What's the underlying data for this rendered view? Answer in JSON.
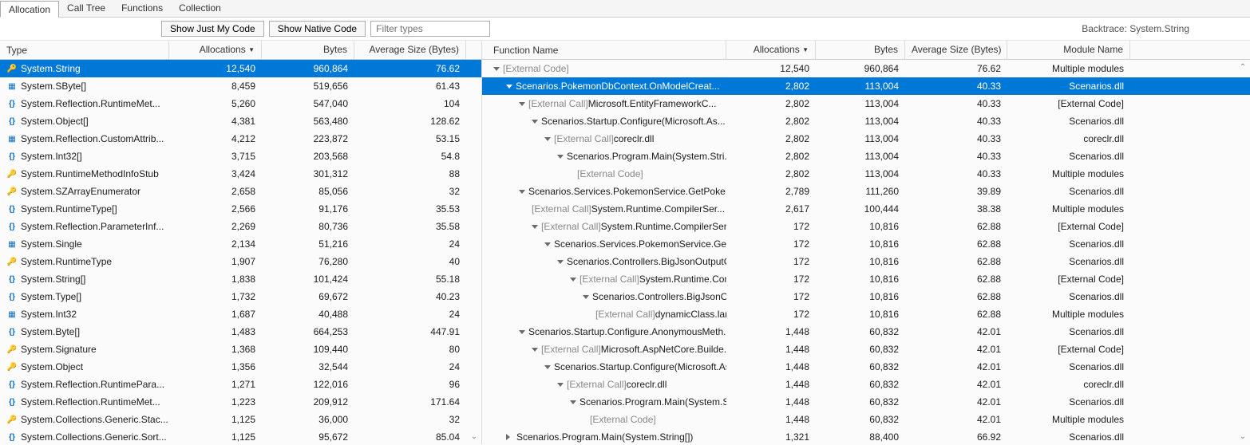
{
  "tabs": [
    "Allocation",
    "Call Tree",
    "Functions",
    "Collection"
  ],
  "active_tab": 0,
  "toolbar": {
    "show_just_my_code": "Show Just My Code",
    "show_native_code": "Show Native Code",
    "filter_placeholder": "Filter types"
  },
  "backtrace_label": "Backtrace:",
  "backtrace_value": "System.String",
  "left": {
    "headers": [
      "Type",
      "Allocations",
      "Bytes",
      "Average Size (Bytes)"
    ],
    "sort_col": 1,
    "rows": [
      {
        "icon": "key",
        "type": "System.String",
        "alloc": "12,540",
        "bytes": "960,864",
        "avg": "76.62",
        "sel": true
      },
      {
        "icon": "struct",
        "type": "System.SByte[]",
        "alloc": "8,459",
        "bytes": "519,656",
        "avg": "61.43"
      },
      {
        "icon": "brace",
        "type": "System.Reflection.RuntimeMet...",
        "alloc": "5,260",
        "bytes": "547,040",
        "avg": "104"
      },
      {
        "icon": "brace",
        "type": "System.Object[]",
        "alloc": "4,381",
        "bytes": "563,480",
        "avg": "128.62"
      },
      {
        "icon": "struct",
        "type": "System.Reflection.CustomAttrib...",
        "alloc": "4,212",
        "bytes": "223,872",
        "avg": "53.15"
      },
      {
        "icon": "brace",
        "type": "System.Int32[]",
        "alloc": "3,715",
        "bytes": "203,568",
        "avg": "54.8"
      },
      {
        "icon": "key",
        "type": "System.RuntimeMethodInfoStub",
        "alloc": "3,424",
        "bytes": "301,312",
        "avg": "88"
      },
      {
        "icon": "key",
        "type": "System.SZArrayEnumerator",
        "alloc": "2,658",
        "bytes": "85,056",
        "avg": "32"
      },
      {
        "icon": "brace",
        "type": "System.RuntimeType[]",
        "alloc": "2,566",
        "bytes": "91,176",
        "avg": "35.53"
      },
      {
        "icon": "brace",
        "type": "System.Reflection.ParameterInf...",
        "alloc": "2,269",
        "bytes": "80,736",
        "avg": "35.58"
      },
      {
        "icon": "struct",
        "type": "System.Single",
        "alloc": "2,134",
        "bytes": "51,216",
        "avg": "24"
      },
      {
        "icon": "key",
        "type": "System.RuntimeType",
        "alloc": "1,907",
        "bytes": "76,280",
        "avg": "40"
      },
      {
        "icon": "brace",
        "type": "System.String[]",
        "alloc": "1,838",
        "bytes": "101,424",
        "avg": "55.18"
      },
      {
        "icon": "brace",
        "type": "System.Type[]",
        "alloc": "1,732",
        "bytes": "69,672",
        "avg": "40.23"
      },
      {
        "icon": "struct",
        "type": "System.Int32",
        "alloc": "1,687",
        "bytes": "40,488",
        "avg": "24"
      },
      {
        "icon": "brace",
        "type": "System.Byte[]",
        "alloc": "1,483",
        "bytes": "664,253",
        "avg": "447.91"
      },
      {
        "icon": "key",
        "type": "System.Signature",
        "alloc": "1,368",
        "bytes": "109,440",
        "avg": "80"
      },
      {
        "icon": "key",
        "type": "System.Object",
        "alloc": "1,356",
        "bytes": "32,544",
        "avg": "24"
      },
      {
        "icon": "brace",
        "type": "System.Reflection.RuntimePara...",
        "alloc": "1,271",
        "bytes": "122,016",
        "avg": "96"
      },
      {
        "icon": "brace",
        "type": "System.Reflection.RuntimeMet...",
        "alloc": "1,223",
        "bytes": "209,912",
        "avg": "171.64"
      },
      {
        "icon": "key",
        "type": "System.Collections.Generic.Stac...",
        "alloc": "1,125",
        "bytes": "36,000",
        "avg": "32"
      },
      {
        "icon": "brace",
        "type": "System.Collections.Generic.Sort...",
        "alloc": "1,125",
        "bytes": "95,672",
        "avg": "85.04"
      }
    ]
  },
  "right": {
    "headers": [
      "Function Name",
      "Allocations",
      "Bytes",
      "Average Size (Bytes)",
      "Module Name"
    ],
    "sort_col": 1,
    "rows": [
      {
        "depth": 0,
        "tw": "open",
        "ext": true,
        "name": "[External Code]",
        "alloc": "12,540",
        "bytes": "960,864",
        "avg": "76.62",
        "mod": "Multiple modules"
      },
      {
        "depth": 1,
        "tw": "open",
        "name": "Scenarios.PokemonDbContext.OnModelCreat...",
        "alloc": "2,802",
        "bytes": "113,004",
        "avg": "40.33",
        "mod": "Scenarios.dll",
        "sel": true
      },
      {
        "depth": 2,
        "tw": "open",
        "extprefix": "[External Call] ",
        "name": "Microsoft.EntityFrameworkC...",
        "alloc": "2,802",
        "bytes": "113,004",
        "avg": "40.33",
        "mod": "[External Code]"
      },
      {
        "depth": 3,
        "tw": "open",
        "name": "Scenarios.Startup.Configure(Microsoft.As...",
        "alloc": "2,802",
        "bytes": "113,004",
        "avg": "40.33",
        "mod": "Scenarios.dll"
      },
      {
        "depth": 4,
        "tw": "open",
        "extprefix": "[External Call] ",
        "name": "coreclr.dll",
        "alloc": "2,802",
        "bytes": "113,004",
        "avg": "40.33",
        "mod": "coreclr.dll"
      },
      {
        "depth": 5,
        "tw": "open",
        "name": "Scenarios.Program.Main(System.Stri...",
        "alloc": "2,802",
        "bytes": "113,004",
        "avg": "40.33",
        "mod": "Scenarios.dll"
      },
      {
        "depth": 6,
        "tw": "",
        "ext": true,
        "name": "[External Code]",
        "alloc": "2,802",
        "bytes": "113,004",
        "avg": "40.33",
        "mod": "Multiple modules"
      },
      {
        "depth": 2,
        "tw": "open",
        "name": "Scenarios.Services.PokemonService.GetPoke...",
        "alloc": "2,789",
        "bytes": "111,260",
        "avg": "39.89",
        "mod": "Scenarios.dll"
      },
      {
        "depth": 3,
        "tw": "",
        "extprefix": "[External Call] ",
        "name": "System.Runtime.CompilerSer...",
        "alloc": "2,617",
        "bytes": "100,444",
        "avg": "38.38",
        "mod": "Multiple modules"
      },
      {
        "depth": 3,
        "tw": "open",
        "extprefix": "[External Call] ",
        "name": "System.Runtime.CompilerSer...",
        "alloc": "172",
        "bytes": "10,816",
        "avg": "62.88",
        "mod": "[External Code]"
      },
      {
        "depth": 4,
        "tw": "open",
        "name": "Scenarios.Services.PokemonService.GetP...",
        "alloc": "172",
        "bytes": "10,816",
        "avg": "62.88",
        "mod": "Scenarios.dll"
      },
      {
        "depth": 5,
        "tw": "open",
        "name": "Scenarios.Controllers.BigJsonOutputC...",
        "alloc": "172",
        "bytes": "10,816",
        "avg": "62.88",
        "mod": "Scenarios.dll"
      },
      {
        "depth": 6,
        "tw": "open",
        "extprefix": "[External Call] ",
        "name": "System.Runtime.Com...",
        "alloc": "172",
        "bytes": "10,816",
        "avg": "62.88",
        "mod": "[External Code]"
      },
      {
        "depth": 7,
        "tw": "open",
        "name": "Scenarios.Controllers.BigJsonOutp...",
        "alloc": "172",
        "bytes": "10,816",
        "avg": "62.88",
        "mod": "Scenarios.dll"
      },
      {
        "depth": 8,
        "tw": "",
        "extprefix": "[External Call] ",
        "name": "dynamicClass.lam...",
        "alloc": "172",
        "bytes": "10,816",
        "avg": "62.88",
        "mod": "Multiple modules"
      },
      {
        "depth": 2,
        "tw": "open",
        "name": "Scenarios.Startup.Configure.AnonymousMeth...",
        "alloc": "1,448",
        "bytes": "60,832",
        "avg": "42.01",
        "mod": "Scenarios.dll"
      },
      {
        "depth": 3,
        "tw": "open",
        "extprefix": "[External Call] ",
        "name": "Microsoft.AspNetCore.Builde...",
        "alloc": "1,448",
        "bytes": "60,832",
        "avg": "42.01",
        "mod": "[External Code]"
      },
      {
        "depth": 4,
        "tw": "open",
        "name": "Scenarios.Startup.Configure(Microsoft.As...",
        "alloc": "1,448",
        "bytes": "60,832",
        "avg": "42.01",
        "mod": "Scenarios.dll"
      },
      {
        "depth": 5,
        "tw": "open",
        "extprefix": "[External Call] ",
        "name": "coreclr.dll",
        "alloc": "1,448",
        "bytes": "60,832",
        "avg": "42.01",
        "mod": "coreclr.dll"
      },
      {
        "depth": 6,
        "tw": "open",
        "name": "Scenarios.Program.Main(System.Stri...",
        "alloc": "1,448",
        "bytes": "60,832",
        "avg": "42.01",
        "mod": "Scenarios.dll"
      },
      {
        "depth": 7,
        "tw": "",
        "ext": true,
        "name": "[External Code]",
        "alloc": "1,448",
        "bytes": "60,832",
        "avg": "42.01",
        "mod": "Multiple modules"
      },
      {
        "depth": 1,
        "tw": "closed",
        "name": "Scenarios.Program.Main(System.String[])",
        "alloc": "1,321",
        "bytes": "88,400",
        "avg": "66.92",
        "mod": "Scenarios.dll"
      }
    ]
  }
}
